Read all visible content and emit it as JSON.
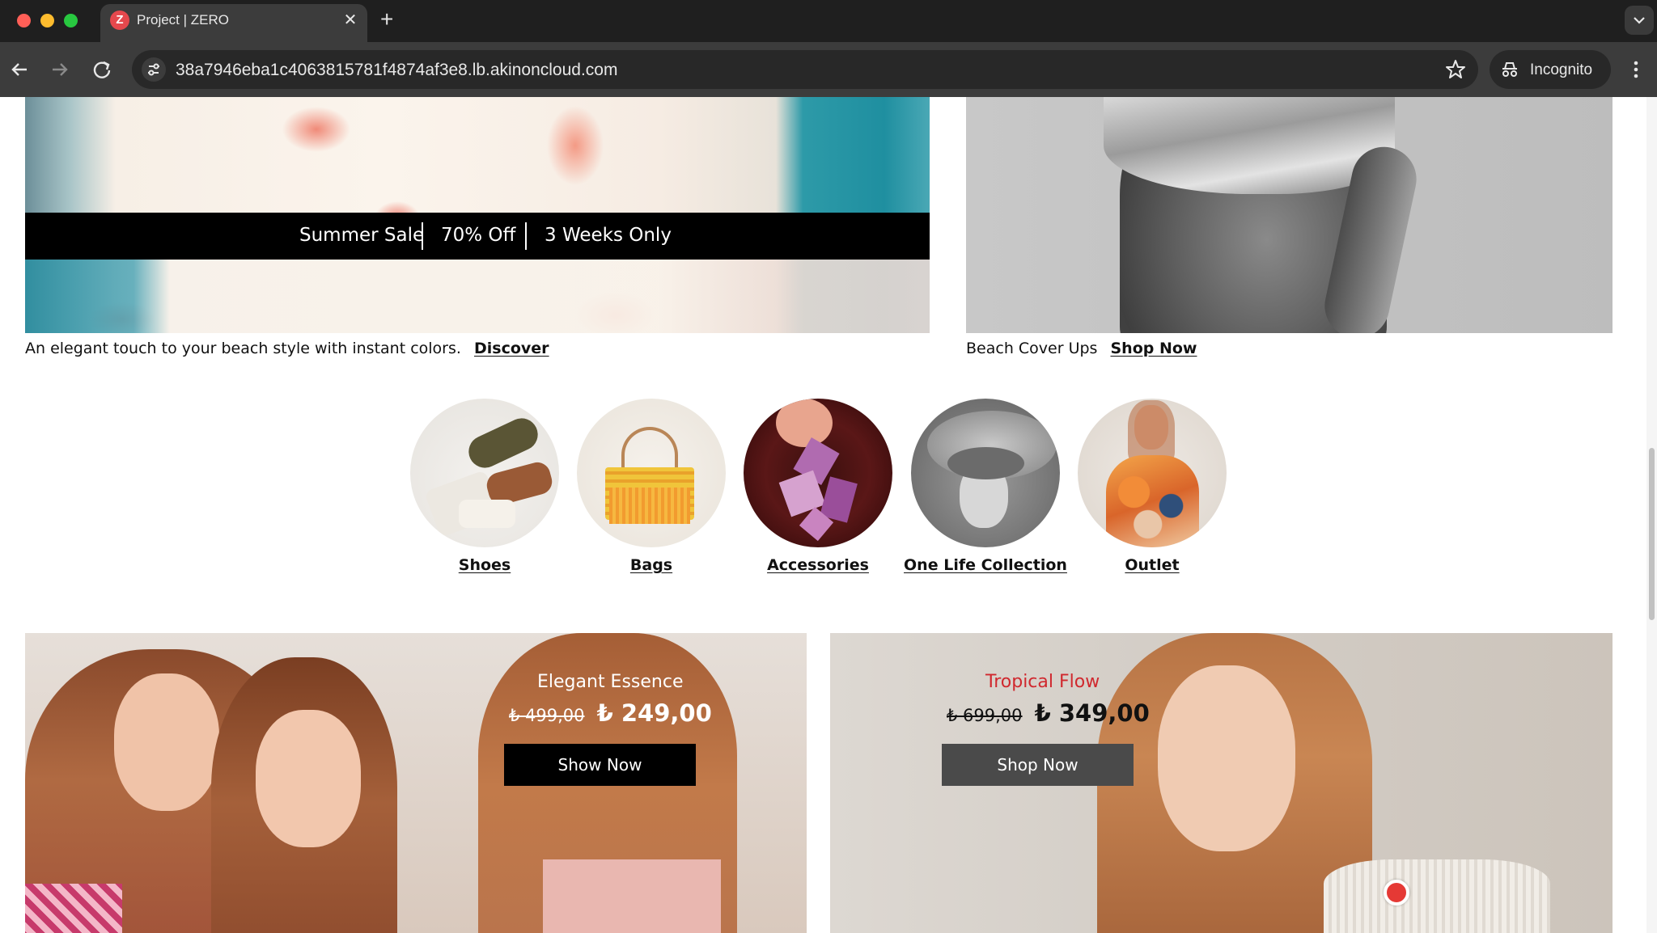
{
  "browser": {
    "tab_title": "Project | ZERO",
    "tab_favicon_letter": "Z",
    "url": "38a7946eba1c4063815781f4874af3e8.lb.akinoncloud.com",
    "incognito_label": "Incognito"
  },
  "banner_left": {
    "sale_items": [
      "Summer Sale",
      "70% Off",
      "3 Weeks Only"
    ],
    "caption": "An elegant touch to your beach style with instant colors.",
    "link": "Discover"
  },
  "banner_right": {
    "caption": "Beach Cover Ups",
    "link": "Shop Now"
  },
  "categories": [
    {
      "label": "Shoes"
    },
    {
      "label": "Bags"
    },
    {
      "label": "Accessories"
    },
    {
      "label": "One Life Collection"
    },
    {
      "label": "Outlet"
    }
  ],
  "promo_left": {
    "title": "Elegant Essence",
    "old_price": "₺ 499,00",
    "new_price": "₺ 249,00",
    "button": "Show Now"
  },
  "promo_right": {
    "title": "Tropical Flow",
    "title_color": "#d0282e",
    "old_price": "₺ 699,00",
    "new_price": "₺ 349,00",
    "button": "Shop Now"
  }
}
